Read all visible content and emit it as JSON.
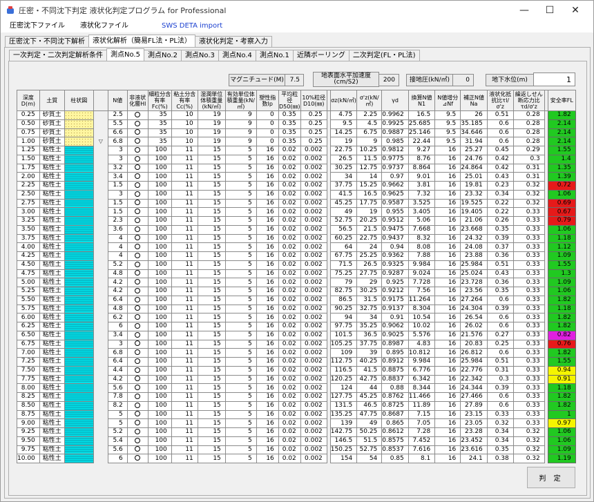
{
  "window": {
    "title": "圧密・不同沈下判定 液状化判定プログラム for Professional",
    "minimize": "—",
    "maximize": "☐",
    "close": "✕"
  },
  "menu": [
    "圧密沈下ファイル",
    "液状化ファイル",
    "SWS DETA import"
  ],
  "menu_colors": {
    "import": "#1a3fcf"
  },
  "main_tabs": [
    "圧密沈下・不同沈下解析",
    "液状化解析（簡易FL法・PL法）",
    "液状化判定・考察入力"
  ],
  "sub_tabs": [
    "一次判定・二次判定解析条件",
    "測点No.5",
    "測点No.2",
    "測点No.3",
    "測点No.4",
    "測点No.1",
    "近隣ボーリング",
    "二次判定(FL・PL法)"
  ],
  "params": {
    "magnitude_label": "マグニチュード(M)",
    "magnitude": "7.5",
    "accel_label": "地表面水平加速度(cm/S2)",
    "accel": "200",
    "contact_label": "接地圧(kN/㎡)",
    "contact": "0",
    "gwl_label": "地下水位(m)",
    "gwl": "1"
  },
  "columns": [
    "深度D(m)",
    "土質",
    "柱状図",
    "N値",
    "非液状化層Hl",
    "細粒分含有率Fc(%)",
    "粘土分含有率Cc(%)",
    "湿潤単位体積重量(kN/㎥)",
    "有効単位体積重量(kN/㎥)",
    "塑性指数Ip",
    "平均粒径D50(㎜)",
    "10%粒径D10(㎜)",
    "σz(kN/㎡)",
    "σ'z(kN/㎡)",
    "γd",
    "換算N値N1",
    "N値增分⊿Nf",
    "補正N値Na",
    "液状化抵抗比τl/σ'z",
    "繰返しせん断応力比τd/σ'z",
    "安全率FL"
  ],
  "water_level_mark": "▽",
  "rows": [
    [
      "0.25",
      "砂質土",
      "",
      "2.5",
      "○",
      "35",
      "10",
      "19",
      "9",
      "0",
      "0.35",
      "0.25",
      "4.75",
      "2.25",
      "0.9962",
      "16.5",
      "9.5",
      "26",
      "0.51",
      "0.28",
      "1.82"
    ],
    [
      "0.50",
      "砂質土",
      "",
      "5.5",
      "○",
      "35",
      "10",
      "19",
      "9",
      "0",
      "0.35",
      "0.25",
      "9.5",
      "4.5",
      "0.9925",
      "25.685",
      "9.5",
      "35.185",
      "0.6",
      "0.28",
      "2.14"
    ],
    [
      "0.75",
      "砂質土",
      "",
      "6.6",
      "○",
      "35",
      "10",
      "19",
      "9",
      "0",
      "0.35",
      "0.25",
      "14.25",
      "6.75",
      "0.9887",
      "25.146",
      "9.5",
      "34.646",
      "0.6",
      "0.28",
      "2.14"
    ],
    [
      "1.00",
      "砂質土",
      "",
      "6.8",
      "○",
      "35",
      "10",
      "19",
      "9",
      "0",
      "0.35",
      "0.25",
      "19",
      "9",
      "0.985",
      "22.44",
      "9.5",
      "31.94",
      "0.6",
      "0.28",
      "2.14"
    ],
    [
      "1.25",
      "粘性土",
      "",
      "3",
      "○",
      "100",
      "11",
      "15",
      "5",
      "16",
      "0.02",
      "0.002",
      "22.75",
      "10.25",
      "0.9812",
      "9.27",
      "16",
      "25.27",
      "0.45",
      "0.29",
      "1.55"
    ],
    [
      "1.50",
      "粘性土",
      "",
      "3",
      "○",
      "100",
      "11",
      "15",
      "5",
      "16",
      "0.02",
      "0.002",
      "26.5",
      "11.5",
      "0.9775",
      "8.76",
      "16",
      "24.76",
      "0.42",
      "0.3",
      "1.4"
    ],
    [
      "1.75",
      "粘性土",
      "",
      "3.2",
      "○",
      "100",
      "11",
      "15",
      "5",
      "16",
      "0.02",
      "0.002",
      "30.25",
      "12.75",
      "0.9737",
      "8.864",
      "16",
      "24.864",
      "0.42",
      "0.31",
      "1.35"
    ],
    [
      "2.00",
      "粘性土",
      "",
      "3.4",
      "○",
      "100",
      "11",
      "15",
      "5",
      "16",
      "0.02",
      "0.002",
      "34",
      "14",
      "0.97",
      "9.01",
      "16",
      "25.01",
      "0.43",
      "0.31",
      "1.39"
    ],
    [
      "2.25",
      "粘性土",
      "",
      "1.5",
      "○",
      "100",
      "11",
      "15",
      "5",
      "16",
      "0.02",
      "0.002",
      "37.75",
      "15.25",
      "0.9662",
      "3.81",
      "16",
      "19.81",
      "0.23",
      "0.32",
      "0.72"
    ],
    [
      "2.50",
      "粘性土",
      "",
      "3",
      "○",
      "100",
      "11",
      "15",
      "5",
      "16",
      "0.02",
      "0.002",
      "41.5",
      "16.5",
      "0.9625",
      "7.32",
      "16",
      "23.32",
      "0.34",
      "0.32",
      "1.06"
    ],
    [
      "2.75",
      "粘性土",
      "",
      "1.5",
      "○",
      "100",
      "11",
      "15",
      "5",
      "16",
      "0.02",
      "0.002",
      "45.25",
      "17.75",
      "0.9587",
      "3.525",
      "16",
      "19.525",
      "0.22",
      "0.32",
      "0.69"
    ],
    [
      "3.00",
      "粘性土",
      "",
      "1.5",
      "○",
      "100",
      "11",
      "15",
      "5",
      "16",
      "0.02",
      "0.002",
      "49",
      "19",
      "0.955",
      "3.405",
      "16",
      "19.405",
      "0.22",
      "0.33",
      "0.67"
    ],
    [
      "3.25",
      "粘性土",
      "",
      "2.3",
      "○",
      "100",
      "11",
      "15",
      "5",
      "16",
      "0.02",
      "0.002",
      "52.75",
      "20.25",
      "0.9512",
      "5.06",
      "16",
      "21.06",
      "0.26",
      "0.33",
      "0.79"
    ],
    [
      "3.50",
      "粘性土",
      "",
      "3.6",
      "○",
      "100",
      "11",
      "15",
      "5",
      "16",
      "0.02",
      "0.002",
      "56.5",
      "21.5",
      "0.9475",
      "7.668",
      "16",
      "23.668",
      "0.35",
      "0.33",
      "1.06"
    ],
    [
      "3.75",
      "粘性土",
      "",
      "4",
      "○",
      "100",
      "11",
      "15",
      "5",
      "16",
      "0.02",
      "0.002",
      "60.25",
      "22.75",
      "0.9437",
      "8.32",
      "16",
      "24.32",
      "0.39",
      "0.33",
      "1.18"
    ],
    [
      "4.00",
      "粘性土",
      "",
      "4",
      "○",
      "100",
      "11",
      "15",
      "5",
      "16",
      "0.02",
      "0.002",
      "64",
      "24",
      "0.94",
      "8.08",
      "16",
      "24.08",
      "0.37",
      "0.33",
      "1.12"
    ],
    [
      "4.25",
      "粘性土",
      "",
      "4",
      "○",
      "100",
      "11",
      "15",
      "5",
      "16",
      "0.02",
      "0.002",
      "67.75",
      "25.25",
      "0.9362",
      "7.88",
      "16",
      "23.88",
      "0.36",
      "0.33",
      "1.09"
    ],
    [
      "4.50",
      "粘性土",
      "",
      "5.2",
      "○",
      "100",
      "11",
      "15",
      "5",
      "16",
      "0.02",
      "0.002",
      "71.5",
      "26.5",
      "0.9325",
      "9.984",
      "16",
      "25.984",
      "0.51",
      "0.33",
      "1.55"
    ],
    [
      "4.75",
      "粘性土",
      "",
      "4.8",
      "○",
      "100",
      "11",
      "15",
      "5",
      "16",
      "0.02",
      "0.002",
      "75.25",
      "27.75",
      "0.9287",
      "9.024",
      "16",
      "25.024",
      "0.43",
      "0.33",
      "1.3"
    ],
    [
      "5.00",
      "粘性土",
      "",
      "4.2",
      "○",
      "100",
      "11",
      "15",
      "5",
      "16",
      "0.02",
      "0.002",
      "79",
      "29",
      "0.925",
      "7.728",
      "16",
      "23.728",
      "0.36",
      "0.33",
      "1.09"
    ],
    [
      "5.25",
      "粘性土",
      "",
      "4.2",
      "○",
      "100",
      "11",
      "15",
      "5",
      "16",
      "0.02",
      "0.002",
      "82.75",
      "30.25",
      "0.9212",
      "7.56",
      "16",
      "23.56",
      "0.35",
      "0.33",
      "1.06"
    ],
    [
      "5.50",
      "粘性土",
      "",
      "6.4",
      "○",
      "100",
      "11",
      "15",
      "5",
      "16",
      "0.02",
      "0.002",
      "86.5",
      "31.5",
      "0.9175",
      "11.264",
      "16",
      "27.264",
      "0.6",
      "0.33",
      "1.82"
    ],
    [
      "5.75",
      "粘性土",
      "",
      "4.8",
      "○",
      "100",
      "11",
      "15",
      "5",
      "16",
      "0.02",
      "0.002",
      "90.25",
      "32.75",
      "0.9137",
      "8.304",
      "16",
      "24.304",
      "0.39",
      "0.33",
      "1.18"
    ],
    [
      "6.00",
      "粘性土",
      "",
      "6.2",
      "○",
      "100",
      "11",
      "15",
      "5",
      "16",
      "0.02",
      "0.002",
      "94",
      "34",
      "0.91",
      "10.54",
      "16",
      "26.54",
      "0.6",
      "0.33",
      "1.82"
    ],
    [
      "6.25",
      "粘性土",
      "",
      "6",
      "○",
      "100",
      "11",
      "15",
      "5",
      "16",
      "0.02",
      "0.002",
      "97.75",
      "35.25",
      "0.9062",
      "10.02",
      "16",
      "26.02",
      "0.6",
      "0.33",
      "1.82"
    ],
    [
      "6.50",
      "粘性土",
      "",
      "3.4",
      "○",
      "100",
      "11",
      "15",
      "5",
      "16",
      "0.02",
      "0.002",
      "101.5",
      "36.5",
      "0.9025",
      "5.576",
      "16",
      "21.576",
      "0.27",
      "0.33",
      "0.82"
    ],
    [
      "6.75",
      "粘性土",
      "",
      "3",
      "○",
      "100",
      "11",
      "15",
      "5",
      "16",
      "0.02",
      "0.002",
      "105.25",
      "37.75",
      "0.8987",
      "4.83",
      "16",
      "20.83",
      "0.25",
      "0.33",
      "0.76"
    ],
    [
      "7.00",
      "粘性土",
      "",
      "6.8",
      "○",
      "100",
      "11",
      "15",
      "5",
      "16",
      "0.02",
      "0.002",
      "109",
      "39",
      "0.895",
      "10.812",
      "16",
      "26.812",
      "0.6",
      "0.33",
      "1.82"
    ],
    [
      "7.25",
      "粘性土",
      "",
      "6.4",
      "○",
      "100",
      "11",
      "15",
      "5",
      "16",
      "0.02",
      "0.002",
      "112.75",
      "40.25",
      "0.8912",
      "9.984",
      "16",
      "25.984",
      "0.51",
      "0.33",
      "1.55"
    ],
    [
      "7.50",
      "粘性土",
      "",
      "4.4",
      "○",
      "100",
      "11",
      "15",
      "5",
      "16",
      "0.02",
      "0.002",
      "116.5",
      "41.5",
      "0.8875",
      "6.776",
      "16",
      "22.776",
      "0.31",
      "0.33",
      "0.94"
    ],
    [
      "7.75",
      "粘性土",
      "",
      "4.2",
      "○",
      "100",
      "11",
      "15",
      "5",
      "16",
      "0.02",
      "0.002",
      "120.25",
      "42.75",
      "0.8837",
      "6.342",
      "16",
      "22.342",
      "0.3",
      "0.33",
      "0.91"
    ],
    [
      "8.00",
      "粘性土",
      "",
      "5.6",
      "○",
      "100",
      "11",
      "15",
      "5",
      "16",
      "0.02",
      "0.002",
      "124",
      "44",
      "0.88",
      "8.344",
      "16",
      "24.344",
      "0.39",
      "0.33",
      "1.18"
    ],
    [
      "8.25",
      "粘性土",
      "",
      "7.8",
      "○",
      "100",
      "11",
      "15",
      "5",
      "16",
      "0.02",
      "0.002",
      "127.75",
      "45.25",
      "0.8762",
      "11.466",
      "16",
      "27.466",
      "0.6",
      "0.33",
      "1.82"
    ],
    [
      "8.50",
      "粘性土",
      "",
      "8.2",
      "○",
      "100",
      "11",
      "15",
      "5",
      "16",
      "0.02",
      "0.002",
      "131.5",
      "46.5",
      "0.8725",
      "11.89",
      "16",
      "27.89",
      "0.6",
      "0.33",
      "1.82"
    ],
    [
      "8.75",
      "粘性土",
      "",
      "5",
      "○",
      "100",
      "11",
      "15",
      "5",
      "16",
      "0.02",
      "0.002",
      "135.25",
      "47.75",
      "0.8687",
      "7.15",
      "16",
      "23.15",
      "0.33",
      "0.33",
      "1"
    ],
    [
      "9.00",
      "粘性土",
      "",
      "5",
      "○",
      "100",
      "11",
      "15",
      "5",
      "16",
      "0.02",
      "0.002",
      "139",
      "49",
      "0.865",
      "7.05",
      "16",
      "23.05",
      "0.32",
      "0.33",
      "0.97"
    ],
    [
      "9.25",
      "粘性土",
      "",
      "5.2",
      "○",
      "100",
      "11",
      "15",
      "5",
      "16",
      "0.02",
      "0.002",
      "142.75",
      "50.25",
      "0.8612",
      "7.28",
      "16",
      "23.28",
      "0.34",
      "0.32",
      "1.06"
    ],
    [
      "9.50",
      "粘性土",
      "",
      "5.4",
      "○",
      "100",
      "11",
      "15",
      "5",
      "16",
      "0.02",
      "0.002",
      "146.5",
      "51.5",
      "0.8575",
      "7.452",
      "16",
      "23.452",
      "0.34",
      "0.32",
      "1.06"
    ],
    [
      "9.75",
      "粘性土",
      "",
      "5.6",
      "○",
      "100",
      "11",
      "15",
      "5",
      "16",
      "0.02",
      "0.002",
      "150.25",
      "52.75",
      "0.8537",
      "7.616",
      "16",
      "23.616",
      "0.35",
      "0.32",
      "1.09"
    ],
    [
      "10.00",
      "粘性土",
      "",
      "6",
      "○",
      "100",
      "11",
      "15",
      "5",
      "16",
      "0.02",
      "0.002",
      "154",
      "54",
      "0.85",
      "8.1",
      "16",
      "24.1",
      "0.38",
      "0.32",
      "1.19"
    ]
  ],
  "fl_colors": {
    "0.25": "#21c921",
    "0.50": "#21c921",
    "0.75": "#21c921",
    "1.00": "#21c921",
    "1.25": "#21c921",
    "1.50": "#21c921",
    "1.75": "#21c921",
    "2.00": "#21c921",
    "2.25": "#e61a1a",
    "2.50": "#21c921",
    "2.75": "#e61a1a",
    "3.00": "#e61a1a",
    "3.25": "#e61a1a",
    "3.50": "#21c921",
    "3.75": "#21c921",
    "4.00": "#21c921",
    "4.25": "#21c921",
    "4.50": "#21c921",
    "4.75": "#21c921",
    "5.00": "#21c921",
    "5.25": "#21c921",
    "5.50": "#21c921",
    "5.75": "#21c921",
    "6.00": "#21c921",
    "6.25": "#21c921",
    "6.50": "#e020e0",
    "6.75": "#e61a1a",
    "7.00": "#21c921",
    "7.25": "#21c921",
    "7.50": "#f5f500",
    "7.75": "#f5f500",
    "8.00": "#21c921",
    "8.25": "#21c921",
    "8.50": "#21c921",
    "8.75": "#21c921",
    "9.00": "#f5f500",
    "9.25": "#21c921",
    "9.50": "#21c921",
    "9.75": "#21c921",
    "10.00": "#21c921"
  },
  "judge_button": "判 定"
}
